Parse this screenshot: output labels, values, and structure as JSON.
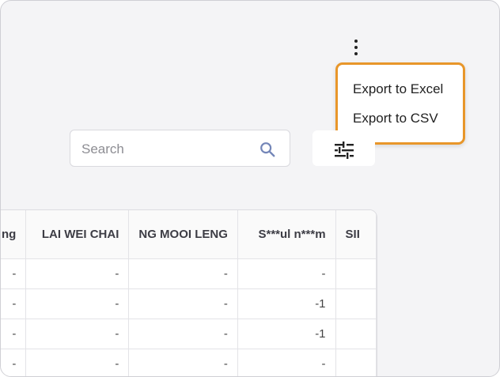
{
  "menu": {
    "items": [
      {
        "label": "Export to Excel"
      },
      {
        "label": "Export to CSV"
      }
    ]
  },
  "search": {
    "placeholder": "Search",
    "value": ""
  },
  "colors": {
    "menu_border": "#e8962a",
    "background": "#f4f4f6"
  },
  "icons": {
    "kebab": "more-vert-icon",
    "search": "search-icon",
    "filter": "tune-icon"
  },
  "table": {
    "headers": [
      "ng",
      "LAI WEI CHAI",
      "NG MOOI LENG",
      "S***ul n***m",
      "SII"
    ],
    "rows": [
      [
        "-",
        "-",
        "-",
        "-",
        ""
      ],
      [
        "-",
        "-",
        "-",
        "-1",
        ""
      ],
      [
        "-",
        "-",
        "-",
        "-1",
        ""
      ],
      [
        "-",
        "-",
        "-",
        "-",
        ""
      ]
    ]
  }
}
